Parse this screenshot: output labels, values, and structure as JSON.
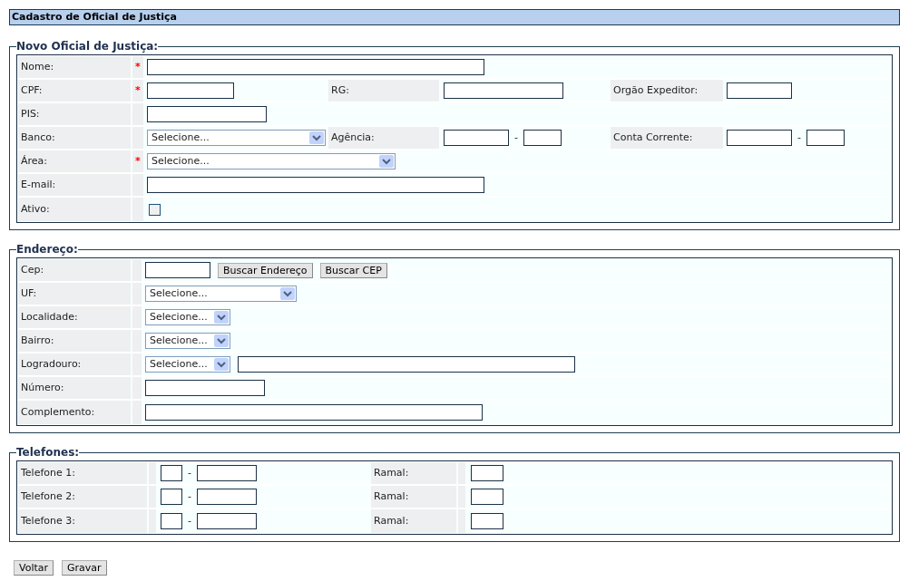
{
  "header": {
    "title": "Cadastro de Oficial de Justiça"
  },
  "novo": {
    "legend": "Novo Oficial de Justiça:",
    "nome": {
      "label": "Nome:",
      "marker": "*"
    },
    "cpf": {
      "label": "CPF:",
      "marker": "*"
    },
    "rg": {
      "label": "RG:"
    },
    "orgao": {
      "label": "Orgão Expeditor:"
    },
    "pis": {
      "label": "PIS:"
    },
    "banco": {
      "label": "Banco:",
      "value": "Selecione..."
    },
    "agencia": {
      "label": "Agência:",
      "separator": "-"
    },
    "conta": {
      "label": "Conta Corrente:",
      "separator": "-"
    },
    "area": {
      "label": "Área:",
      "marker": "*",
      "value": "Selecione..."
    },
    "email": {
      "label": "E-mail:"
    },
    "ativo": {
      "label": "Ativo:",
      "checked": false
    }
  },
  "endereco": {
    "legend": "Endereço:",
    "cep": {
      "label": "Cep:",
      "buttons": [
        "Buscar Endereço",
        "Buscar CEP"
      ]
    },
    "uf": {
      "label": "UF:",
      "value": "Selecione..."
    },
    "localidade": {
      "label": "Localidade:",
      "value": "Selecione..."
    },
    "bairro": {
      "label": "Bairro:",
      "value": "Selecione..."
    },
    "logradouro": {
      "label": "Logradouro:",
      "value": "Selecione..."
    },
    "numero": {
      "label": "Número:"
    },
    "complemento": {
      "label": "Complemento:"
    }
  },
  "telefones": {
    "legend": "Telefones:",
    "rows": [
      {
        "label": "Telefone 1:",
        "separator": "-",
        "ramal_label": "Ramal:"
      },
      {
        "label": "Telefone 2:",
        "separator": "-",
        "ramal_label": "Ramal:"
      },
      {
        "label": "Telefone 3:",
        "separator": "-",
        "ramal_label": "Ramal:"
      }
    ]
  },
  "buttons": [
    "Voltar",
    "Gravar"
  ]
}
